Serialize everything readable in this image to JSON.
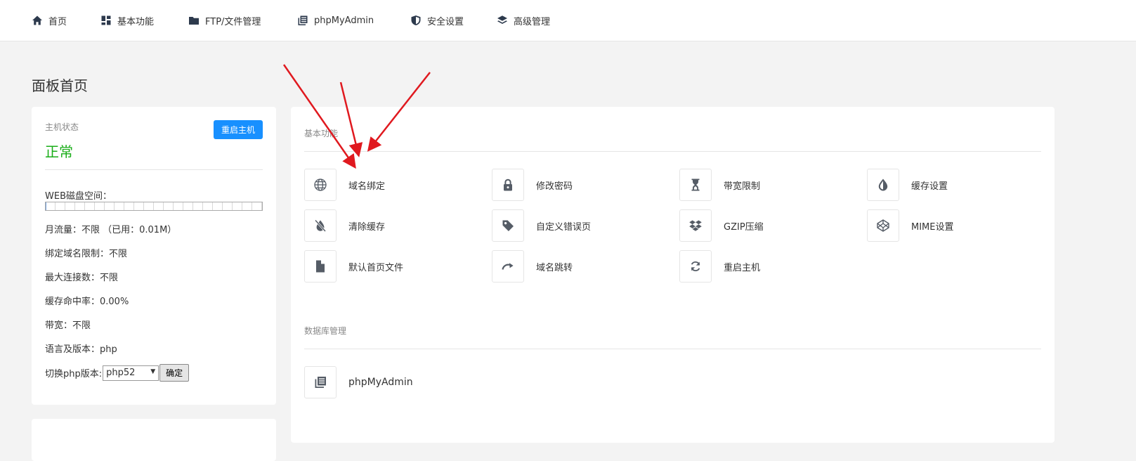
{
  "nav": [
    {
      "label": "首页",
      "icon": "home-icon"
    },
    {
      "label": "基本功能",
      "icon": "dashboard-icon"
    },
    {
      "label": "FTP/文件管理",
      "icon": "folder-icon"
    },
    {
      "label": "phpMyAdmin",
      "icon": "database-icon"
    },
    {
      "label": "安全设置",
      "icon": "shield-icon"
    },
    {
      "label": "高级管理",
      "icon": "layers-icon"
    }
  ],
  "page_title": "面板首页",
  "host": {
    "status_label": "主机状态",
    "status_value": "正常",
    "restart_button": "重启主机",
    "disk_label": "WEB磁盘空间：",
    "disk_usage_fraction": 0.004,
    "rows": [
      "月流量：不限  （已用：0.01M）",
      "绑定域名限制：不限",
      "最大连接数：不限",
      "缓存命中率：0.00%",
      "带宽：不限",
      "语言及版本：php"
    ],
    "php_switch_label": "切换php版本:",
    "php_selected": "php52",
    "php_confirm": "确定"
  },
  "basic_section": {
    "title": "基本功能",
    "items": [
      {
        "label": "域名绑定",
        "icon": "globe-icon"
      },
      {
        "label": "修改密码",
        "icon": "lock-icon"
      },
      {
        "label": "带宽限制",
        "icon": "hourglass-icon"
      },
      {
        "label": "缓存设置",
        "icon": "adjust-icon"
      },
      {
        "label": "清除缓存",
        "icon": "broom-icon"
      },
      {
        "label": "自定义错误页",
        "icon": "tag-icon"
      },
      {
        "label": "GZIP压缩",
        "icon": "dropbox-icon"
      },
      {
        "label": "MIME设置",
        "icon": "codepen-icon"
      },
      {
        "label": "默认首页文件",
        "icon": "file-icon"
      },
      {
        "label": "域名跳转",
        "icon": "redirect-icon"
      },
      {
        "label": "重启主机",
        "icon": "refresh-icon"
      }
    ]
  },
  "db_section": {
    "title": "数据库管理",
    "items": [
      {
        "label": "phpMyAdmin",
        "icon": "database-icon"
      }
    ]
  },
  "colors": {
    "accent": "#1890ff",
    "status_ok": "#1aad19",
    "annotation_arrow": "#e0191f"
  }
}
